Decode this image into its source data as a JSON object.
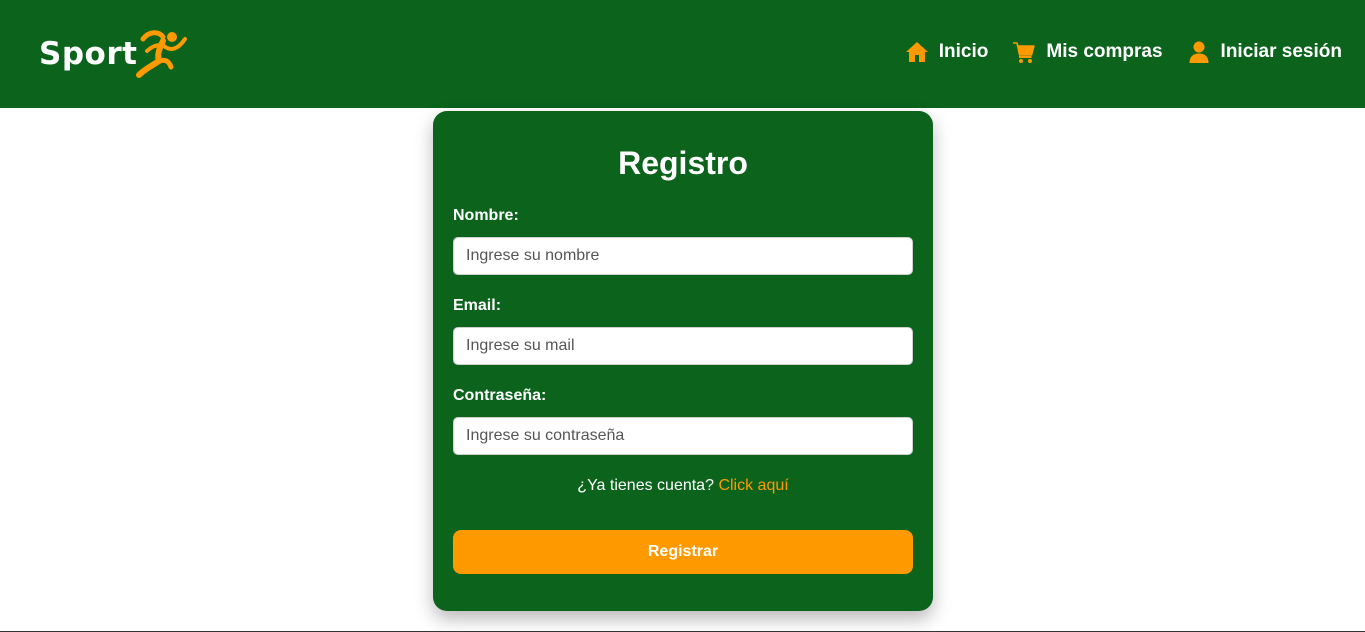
{
  "brand": {
    "name": "Sport",
    "accent_color": "#ff9900",
    "primary_color": "#0b631c",
    "logo_icon": "runner-icon"
  },
  "nav": {
    "items": [
      {
        "label": "Inicio",
        "icon": "home-icon"
      },
      {
        "label": "Mis compras",
        "icon": "cart-icon"
      },
      {
        "label": "Iniciar sesión",
        "icon": "user-icon"
      }
    ]
  },
  "form": {
    "title": "Registro",
    "fields": [
      {
        "label": "Nombre:",
        "placeholder": "Ingrese su nombre",
        "value": ""
      },
      {
        "label": "Email:",
        "placeholder": "Ingrese su mail",
        "value": ""
      },
      {
        "label": "Contraseña:",
        "placeholder": "Ingrese su contraseña",
        "value": ""
      }
    ],
    "account_prompt": "¿Ya tienes cuenta?",
    "account_link": "Click aquí",
    "submit_label": "Registrar"
  }
}
